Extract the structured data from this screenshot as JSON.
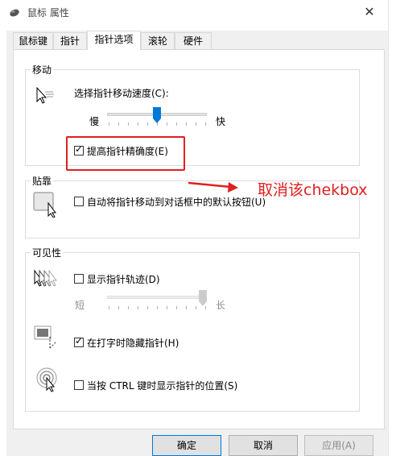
{
  "window": {
    "title": "鼠标 属性",
    "close_glyph": "✕"
  },
  "tabs": [
    {
      "label": "鼠标键",
      "active": false
    },
    {
      "label": "指针",
      "active": false
    },
    {
      "label": "指针选项",
      "active": true
    },
    {
      "label": "滚轮",
      "active": false
    },
    {
      "label": "硬件",
      "active": false
    }
  ],
  "motion": {
    "group_title": "移动",
    "speed_label": "选择指针移动速度(C):",
    "slow_label": "慢",
    "fast_label": "快",
    "speed_value_fraction": 0.5,
    "enhance_precision": {
      "label": "提高指针精确度(E)",
      "checked": true
    }
  },
  "snap_to": {
    "group_title": "贴靠",
    "auto_move": {
      "label": "自动将指针移动到对话框中的默认按钮(U)",
      "checked": false
    }
  },
  "visibility": {
    "group_title": "可见性",
    "trails": {
      "label": "显示指针轨迹(D)",
      "checked": false
    },
    "short_label": "短",
    "long_label": "长",
    "trail_value_fraction": 1.0,
    "hide_typing": {
      "label": "在打字时隐藏指针(H)",
      "checked": true
    },
    "show_ctrl": {
      "label": "当按 CTRL 键时显示指针的位置(S)",
      "checked": false
    }
  },
  "buttons": {
    "ok": "确定",
    "cancel": "取消",
    "apply": "应用(A)"
  },
  "annotation": {
    "text": "取消该chekbox",
    "color": "#e02020"
  },
  "colors": {
    "slider_thumb": "#0078d7",
    "accent": "#0078d7"
  }
}
